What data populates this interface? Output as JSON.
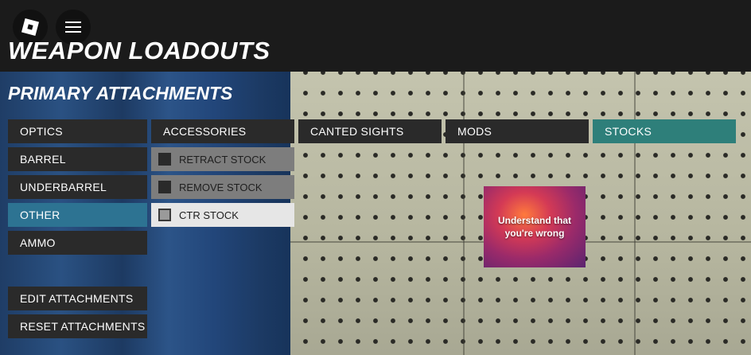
{
  "header": {
    "title": "WEAPON LOADOUTS"
  },
  "panel": {
    "title": "PRIMARY ATTACHMENTS",
    "categories": [
      {
        "label": "OPTICS",
        "selected": false
      },
      {
        "label": "BARREL",
        "selected": false
      },
      {
        "label": "UNDERBARREL",
        "selected": false
      },
      {
        "label": "OTHER",
        "selected": true
      },
      {
        "label": "AMMO",
        "selected": false
      }
    ],
    "actions": {
      "edit": "EDIT ATTACHMENTS",
      "reset": "RESET ATTACHMENTS"
    }
  },
  "subcategories": [
    {
      "label": "ACCESSORIES",
      "selected": false
    },
    {
      "label": "CANTED SIGHTS",
      "selected": false
    },
    {
      "label": "MODS",
      "selected": false
    },
    {
      "label": "STOCKS",
      "selected": true
    }
  ],
  "accessories": [
    {
      "label": "RETRACT STOCK",
      "checked": false
    },
    {
      "label": "REMOVE STOCK",
      "checked": false
    },
    {
      "label": "CTR STOCK",
      "checked": true
    }
  ],
  "poster": {
    "line1": "Understand that",
    "line2": "you're wrong"
  },
  "colors": {
    "selected_category": "#2d7392",
    "selected_tab": "#2e7f7a",
    "button_bg": "#2a2a2a",
    "topbar": "#1b1b1b"
  }
}
